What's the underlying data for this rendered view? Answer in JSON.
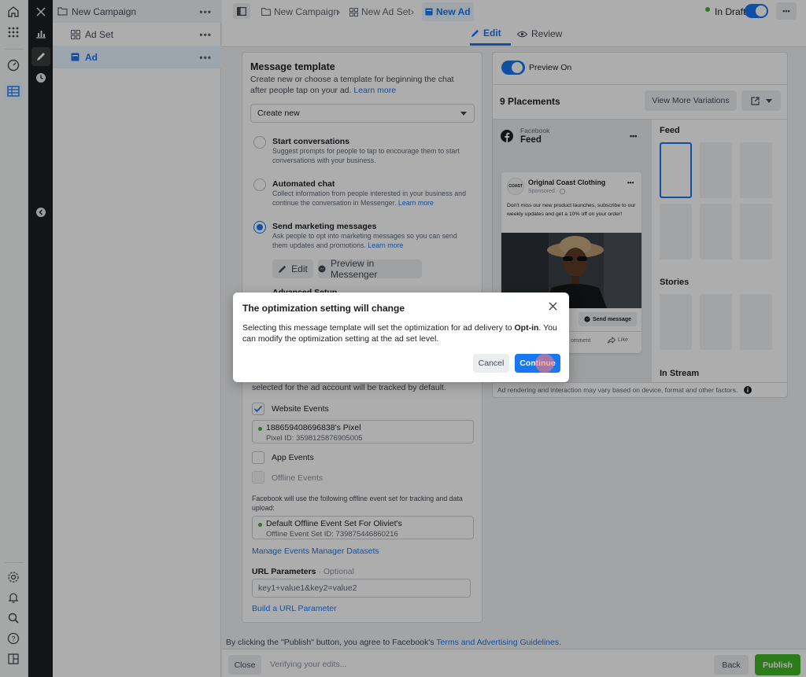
{
  "tree": {
    "campaign": "New Campaign",
    "adset": "Ad Set",
    "ad": "Ad",
    "more": "•••"
  },
  "topbar": {
    "crumbs": [
      "New Campaign",
      "New Ad Set",
      "New Ad"
    ],
    "status": "In Draft",
    "tabs": {
      "edit": "Edit",
      "review": "Review"
    },
    "more": "•••"
  },
  "template": {
    "title": "Message template",
    "desc": "Create new or choose a template for beginning the chat after people tap on your ad.",
    "learn_more": "Learn  more",
    "select_value": "Create new",
    "options": [
      {
        "title": "Start conversations",
        "desc": "Suggest prompts for people to tap to encourage them to start conversations with your business.",
        "link": ""
      },
      {
        "title": "Automated chat",
        "desc": "Collect information from people interested in your business and continue the conversation in Messenger.",
        "link": "Learn more"
      },
      {
        "title": "Send marketing messages",
        "desc": "Ask people to opt into marketing messages so you can send them updates and promotions.",
        "link": "Learn more"
      }
    ],
    "edit_btn": "Edit",
    "preview_btn": "Preview in Messenger",
    "advanced_partial": "Advanced Setup"
  },
  "tracking": {
    "intro_tail": "selected for the ad account will be tracked by default.",
    "website_events": "Website Events",
    "pixel_name": "188659408696838's Pixel",
    "pixel_id": "Pixel ID: 3598125876905005",
    "app_events": "App Events",
    "offline_events": "Offline Events",
    "offline_note": "Facebook will use the following offline event set for tracking and data upload:",
    "offline_set_name": "Default Offline Event Set For Oliviet's",
    "offline_set_id": "Offline Event Set ID: 739875446860216",
    "manage_link": "Manage Events Manager Datasets",
    "url_params_label": "URL Parameters",
    "url_params_optional": "· Optional",
    "url_params_value": "key1+value1&key2=value2",
    "build_link": "Build a URL Parameter"
  },
  "preview": {
    "toggle_label": "Preview On",
    "placements": "9 Placements",
    "view_more": "View More Variations",
    "platform": "Facebook",
    "feed_label": "Feed",
    "page_name": "Original Coast Clothing",
    "sponsored": "Sponsored · ",
    "ad_text": "Don't miss our new product launches, subscribe to our weekly updates and get a 10% off on your order!",
    "send_message": "Send message",
    "comment": "omment",
    "like": "Like",
    "side_feed": "Feed",
    "side_stories": "Stories",
    "side_instream": "In Stream",
    "footer_note": "Ad rendering and interaction may vary based on device, format and other factors.",
    "more": "•••",
    "logo_text": "COAST"
  },
  "modal": {
    "title": "The optimization setting will change",
    "body_pre": "Selecting this message template will set the optimization for ad delivery to ",
    "body_bold": "Opt-in",
    "body_post": ". You can modify the optimization setting at the ad set level.",
    "cancel": "Cancel",
    "continue": "Continue"
  },
  "bottom": {
    "terms_pre": "By clicking the \"Publish\" button, you agree to Facebook's ",
    "terms_link": "Terms and Advertising Guidelines",
    "terms_post": ".",
    "close": "Close",
    "verifying": "Verifying your edits...",
    "back": "Back",
    "publish": "Publish"
  },
  "colors": {
    "accent": "#1877f2",
    "publish": "#42b72a",
    "draft_dot": "#42b72a"
  }
}
